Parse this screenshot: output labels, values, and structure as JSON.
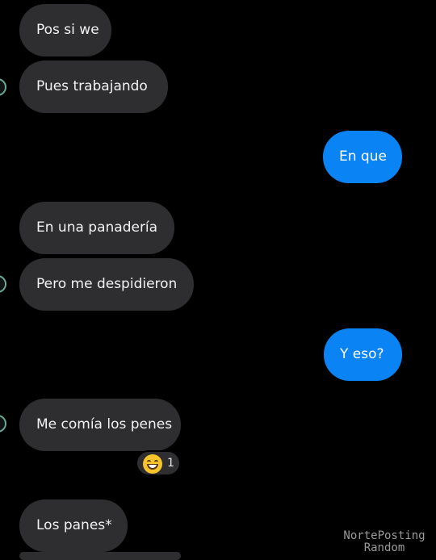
{
  "messages": [
    {
      "side": "incoming",
      "text": "Pos si we"
    },
    {
      "side": "incoming",
      "text": "Pues trabajando"
    },
    {
      "side": "outgoing",
      "text": "En que"
    },
    {
      "side": "incoming",
      "text": "En una panadería"
    },
    {
      "side": "incoming",
      "text": "Pero me despidieron"
    },
    {
      "side": "outgoing",
      "text": "Y eso?"
    },
    {
      "side": "incoming",
      "text": "Me comía los penes"
    },
    {
      "side": "incoming",
      "text": "Los panes*"
    }
  ],
  "reaction": {
    "icon": "grinning-face-icon",
    "count": "1"
  },
  "watermark": {
    "line1": "NortePosting",
    "line2": "Random"
  },
  "colors": {
    "background": "#000000",
    "incoming_bubble": "#2e2e30",
    "outgoing_bubble": "#0a84f5",
    "avatar_ring": "#6aa89a"
  }
}
